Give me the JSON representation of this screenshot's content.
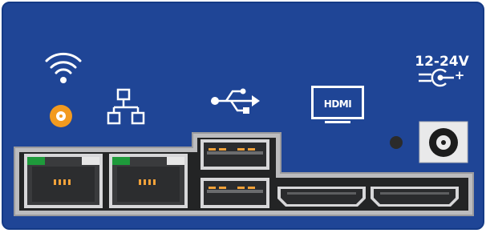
{
  "panel": {
    "title": "",
    "colors": {
      "panel_blue": "#1f4596",
      "panel_edge": "#143a86",
      "antenna_orange": "#f29a1f",
      "led_green": "#1e9a3b",
      "pins_orange": "#f2a23a"
    },
    "icons": [
      "wifi-icon",
      "antenna-connector",
      "ethernet-icon",
      "usb-icon",
      "hdmi-icon",
      "dc-polarity-icon"
    ],
    "hdmi_label": "HDMI",
    "power_label": "12-24V",
    "power_polarity_sign": "+"
  },
  "ports": {
    "ethernet": [
      {
        "name": "ethernet-port-1"
      },
      {
        "name": "ethernet-port-2"
      }
    ],
    "usb": [
      {
        "name": "usb-port-top"
      },
      {
        "name": "usb-port-bottom"
      }
    ],
    "hdmi": [
      {
        "name": "hdmi-port-1"
      },
      {
        "name": "hdmi-port-2"
      }
    ],
    "dc_jack": {
      "name": "dc-power-jack"
    }
  }
}
